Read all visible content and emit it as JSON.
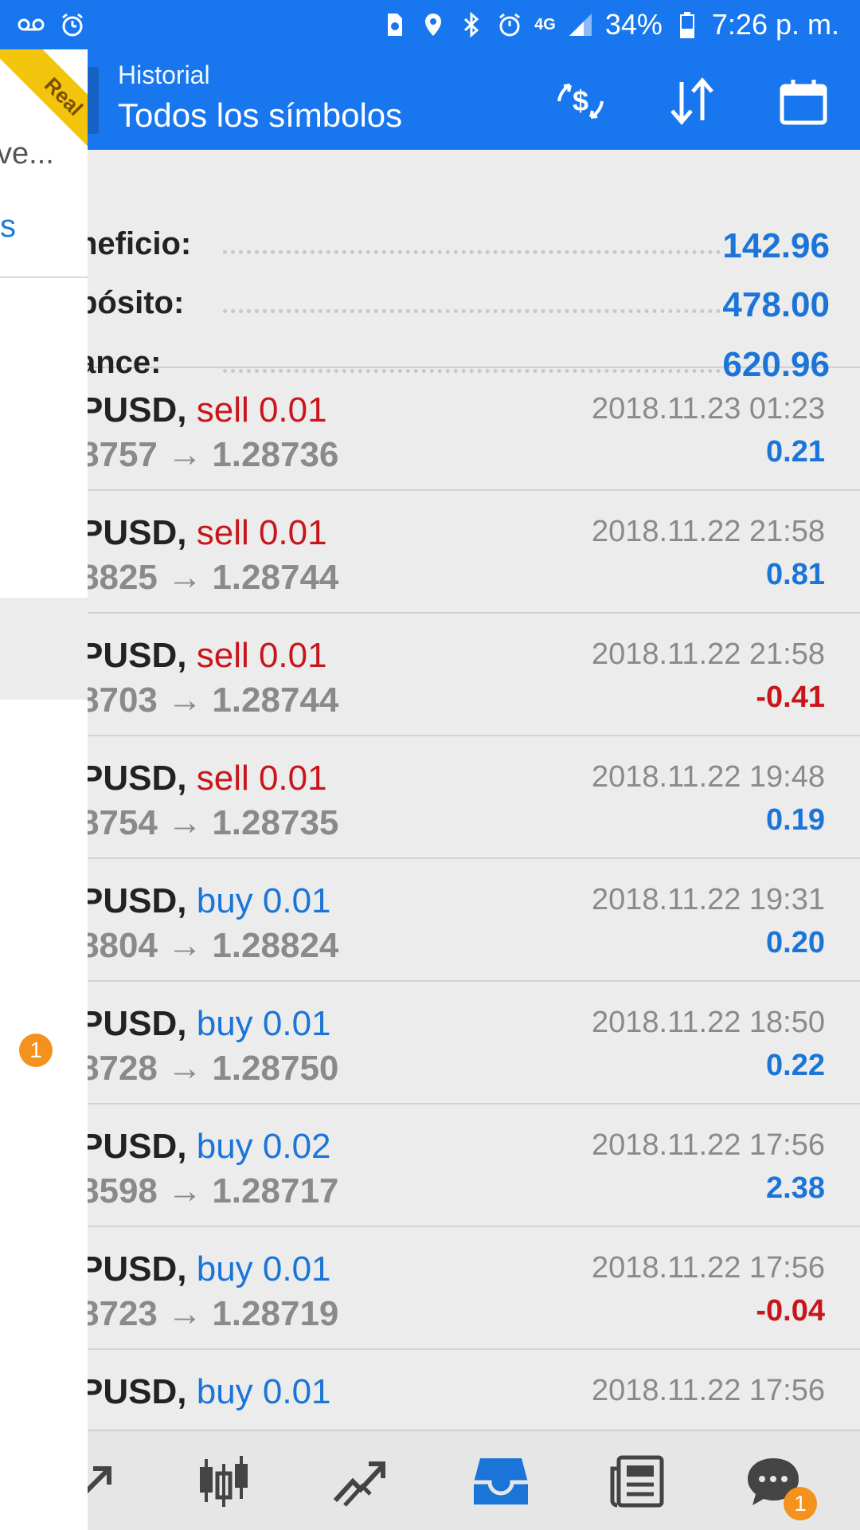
{
  "status_bar": {
    "battery": "34%",
    "time": "7:26 p. m.",
    "network": "4G",
    "icons": [
      "voicemail-icon",
      "alarm-icon",
      "sim-icon",
      "location-icon",
      "bluetooth-icon",
      "alarm-icon",
      "signal-icon",
      "battery-icon"
    ]
  },
  "drawer": {
    "partial_text_1": "ve...",
    "partial_text_2": "s",
    "notification_count": "1"
  },
  "ribbon": {
    "label": "Real"
  },
  "header": {
    "subtitle": "Historial",
    "title": "Todos los símbolos",
    "actions": [
      "currency-exchange-icon",
      "sort-icon",
      "calendar-icon"
    ]
  },
  "summary": {
    "rows": [
      {
        "label": "neficio:",
        "value": "142.96"
      },
      {
        "label": "pósito:",
        "value": "478.00"
      },
      {
        "label": "ance:",
        "value": "620.96"
      }
    ]
  },
  "deals": [
    {
      "symbol": "PUSD,",
      "side": "sell 0.01",
      "side_type": "sell",
      "prices": "8757 → 1.28736",
      "time": "2018.11.23 01:23",
      "profit": "0.21",
      "profit_sign": "pos"
    },
    {
      "symbol": "PUSD,",
      "side": "sell 0.01",
      "side_type": "sell",
      "prices": "8825 → 1.28744",
      "time": "2018.11.22 21:58",
      "profit": "0.81",
      "profit_sign": "pos"
    },
    {
      "symbol": "PUSD,",
      "side": "sell 0.01",
      "side_type": "sell",
      "prices": "8703 → 1.28744",
      "time": "2018.11.22 21:58",
      "profit": "-0.41",
      "profit_sign": "neg"
    },
    {
      "symbol": "PUSD,",
      "side": "sell 0.01",
      "side_type": "sell",
      "prices": "8754 → 1.28735",
      "time": "2018.11.22 19:48",
      "profit": "0.19",
      "profit_sign": "pos"
    },
    {
      "symbol": "PUSD,",
      "side": "buy 0.01",
      "side_type": "buy",
      "prices": "8804 → 1.28824",
      "time": "2018.11.22 19:31",
      "profit": "0.20",
      "profit_sign": "pos"
    },
    {
      "symbol": "PUSD,",
      "side": "buy 0.01",
      "side_type": "buy",
      "prices": "8728 → 1.28750",
      "time": "2018.11.22 18:50",
      "profit": "0.22",
      "profit_sign": "pos"
    },
    {
      "symbol": "PUSD,",
      "side": "buy 0.02",
      "side_type": "buy",
      "prices": "8598 → 1.28717",
      "time": "2018.11.22 17:56",
      "profit": "2.38",
      "profit_sign": "pos"
    },
    {
      "symbol": "PUSD,",
      "side": "buy 0.01",
      "side_type": "buy",
      "prices": "8723 → 1.28719",
      "time": "2018.11.22 17:56",
      "profit": "-0.04",
      "profit_sign": "neg"
    },
    {
      "symbol": "PUSD,",
      "side": "buy 0.01",
      "side_type": "buy",
      "prices": "",
      "time": "2018.11.22 17:56",
      "profit": "",
      "profit_sign": "neg"
    }
  ],
  "bottom_nav": {
    "items": [
      "quotes-icon",
      "chart-candles-icon",
      "trade-icon",
      "history-inbox-icon",
      "news-icon",
      "chat-icon"
    ],
    "active": "history-inbox-icon",
    "chat_badge": "1"
  },
  "colors": {
    "primary": "#1877ee",
    "sell": "#c8161b",
    "buy": "#1b75d8",
    "badge": "#f5921e",
    "ribbon": "#f2c40b"
  }
}
